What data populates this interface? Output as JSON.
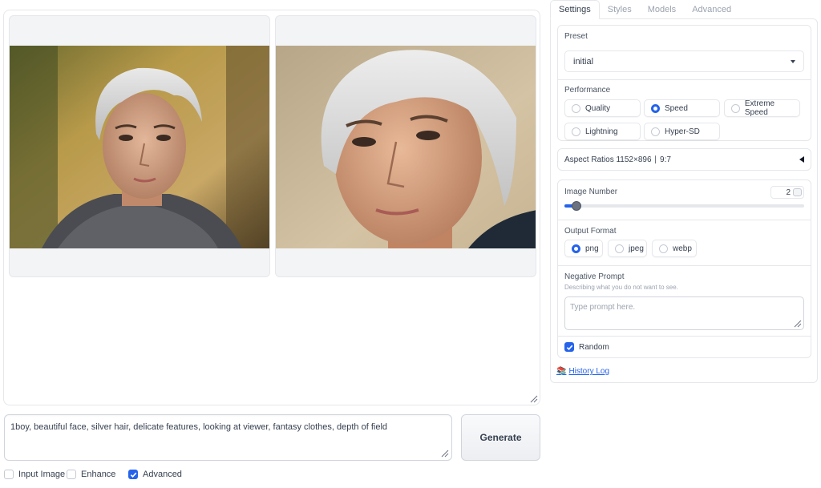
{
  "prompt": {
    "value": "1boy, beautiful face, silver hair, delicate features, looking at viewer, fantasy clothes, depth of field"
  },
  "generate_label": "Generate",
  "bottom_options": [
    {
      "label": "Input Image",
      "checked": false
    },
    {
      "label": "Enhance",
      "checked": false
    },
    {
      "label": "Advanced",
      "checked": true
    }
  ],
  "tabs": [
    "Settings",
    "Styles",
    "Models",
    "Advanced"
  ],
  "settings": {
    "preset": {
      "label": "Preset",
      "value": "initial"
    },
    "performance": {
      "label": "Performance",
      "options": [
        "Quality",
        "Speed",
        "Extreme Speed",
        "Lightning",
        "Hyper-SD"
      ],
      "selected": "Speed"
    },
    "aspect_ratios": {
      "label": "Aspect Ratios 1152×896 ∣ 9:7"
    },
    "image_number": {
      "label": "Image Number",
      "value": "2",
      "level_fraction": 0.05
    },
    "output_format": {
      "label": "Output Format",
      "options": [
        "png",
        "jpeg",
        "webp"
      ],
      "selected": "png"
    },
    "negative_prompt": {
      "label": "Negative Prompt",
      "info": "Describing what you do not want to see.",
      "placeholder": "Type prompt here."
    },
    "random": {
      "label": "Random",
      "checked": true
    }
  },
  "history_log": {
    "icon": "📚",
    "label": "History Log"
  },
  "colors": {
    "accent": "#2563eb"
  }
}
